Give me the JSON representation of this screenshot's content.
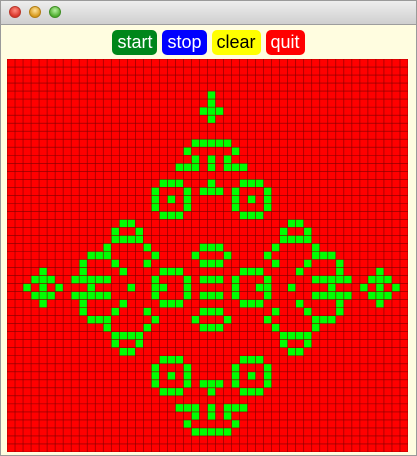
{
  "window": {
    "title": ""
  },
  "toolbar": {
    "buttons": [
      {
        "id": "start",
        "label": "start",
        "bg": "#00861a",
        "fg": "#ffffff"
      },
      {
        "id": "stop",
        "label": "stop",
        "bg": "#0000ff",
        "fg": "#ffffff"
      },
      {
        "id": "clear",
        "label": "clear",
        "bg": "#ffff00",
        "fg": "#000000"
      },
      {
        "id": "quit",
        "label": "quit",
        "bg": "#ff0000",
        "fg": "#ffffff"
      }
    ]
  },
  "grid": {
    "cols": 50,
    "rows": 49,
    "dead_color": "#ff0000",
    "alive_color": "#00ff00",
    "line_color": "#7f0000",
    "alive_cells": [
      [
        25,
        4
      ],
      [
        25,
        5
      ],
      [
        24,
        6
      ],
      [
        25,
        6
      ],
      [
        26,
        6
      ],
      [
        25,
        7
      ],
      [
        23,
        10
      ],
      [
        24,
        10
      ],
      [
        25,
        10
      ],
      [
        26,
        10
      ],
      [
        27,
        10
      ],
      [
        22,
        11
      ],
      [
        28,
        11
      ],
      [
        23,
        12
      ],
      [
        25,
        12
      ],
      [
        27,
        12
      ],
      [
        21,
        13
      ],
      [
        22,
        13
      ],
      [
        23,
        13
      ],
      [
        25,
        13
      ],
      [
        27,
        13
      ],
      [
        28,
        13
      ],
      [
        29,
        13
      ],
      [
        19,
        15
      ],
      [
        20,
        15
      ],
      [
        21,
        15
      ],
      [
        25,
        15
      ],
      [
        29,
        15
      ],
      [
        30,
        15
      ],
      [
        31,
        15
      ],
      [
        18,
        16
      ],
      [
        22,
        16
      ],
      [
        24,
        16
      ],
      [
        25,
        16
      ],
      [
        26,
        16
      ],
      [
        28,
        16
      ],
      [
        32,
        16
      ],
      [
        18,
        17
      ],
      [
        20,
        17
      ],
      [
        22,
        17
      ],
      [
        28,
        17
      ],
      [
        30,
        17
      ],
      [
        32,
        17
      ],
      [
        18,
        18
      ],
      [
        22,
        18
      ],
      [
        28,
        18
      ],
      [
        32,
        18
      ],
      [
        19,
        19
      ],
      [
        20,
        19
      ],
      [
        21,
        19
      ],
      [
        29,
        19
      ],
      [
        30,
        19
      ],
      [
        31,
        19
      ],
      [
        14,
        20
      ],
      [
        15,
        20
      ],
      [
        35,
        20
      ],
      [
        36,
        20
      ],
      [
        13,
        21
      ],
      [
        16,
        21
      ],
      [
        34,
        21
      ],
      [
        37,
        21
      ],
      [
        13,
        22
      ],
      [
        14,
        22
      ],
      [
        15,
        22
      ],
      [
        16,
        22
      ],
      [
        34,
        22
      ],
      [
        35,
        22
      ],
      [
        36,
        22
      ],
      [
        37,
        22
      ],
      [
        12,
        23
      ],
      [
        17,
        23
      ],
      [
        24,
        23
      ],
      [
        25,
        23
      ],
      [
        26,
        23
      ],
      [
        33,
        23
      ],
      [
        38,
        23
      ],
      [
        10,
        24
      ],
      [
        11,
        24
      ],
      [
        12,
        24
      ],
      [
        18,
        24
      ],
      [
        23,
        24
      ],
      [
        27,
        24
      ],
      [
        32,
        24
      ],
      [
        38,
        24
      ],
      [
        39,
        24
      ],
      [
        40,
        24
      ],
      [
        9,
        25
      ],
      [
        13,
        25
      ],
      [
        17,
        25
      ],
      [
        24,
        25
      ],
      [
        25,
        25
      ],
      [
        26,
        25
      ],
      [
        33,
        25
      ],
      [
        37,
        25
      ],
      [
        41,
        25
      ],
      [
        4,
        26
      ],
      [
        9,
        26
      ],
      [
        14,
        26
      ],
      [
        19,
        26
      ],
      [
        20,
        26
      ],
      [
        21,
        26
      ],
      [
        29,
        26
      ],
      [
        30,
        26
      ],
      [
        31,
        26
      ],
      [
        36,
        26
      ],
      [
        41,
        26
      ],
      [
        46,
        26
      ],
      [
        3,
        27
      ],
      [
        4,
        27
      ],
      [
        5,
        27
      ],
      [
        8,
        27
      ],
      [
        9,
        27
      ],
      [
        10,
        27
      ],
      [
        11,
        27
      ],
      [
        12,
        27
      ],
      [
        18,
        27
      ],
      [
        22,
        27
      ],
      [
        24,
        27
      ],
      [
        25,
        27
      ],
      [
        26,
        27
      ],
      [
        28,
        27
      ],
      [
        32,
        27
      ],
      [
        38,
        27
      ],
      [
        39,
        27
      ],
      [
        40,
        27
      ],
      [
        41,
        27
      ],
      [
        42,
        27
      ],
      [
        45,
        27
      ],
      [
        46,
        27
      ],
      [
        47,
        27
      ],
      [
        2,
        28
      ],
      [
        4,
        28
      ],
      [
        6,
        28
      ],
      [
        10,
        28
      ],
      [
        15,
        28
      ],
      [
        18,
        28
      ],
      [
        19,
        28
      ],
      [
        22,
        28
      ],
      [
        28,
        28
      ],
      [
        31,
        28
      ],
      [
        32,
        28
      ],
      [
        35,
        28
      ],
      [
        40,
        28
      ],
      [
        44,
        28
      ],
      [
        46,
        28
      ],
      [
        48,
        28
      ],
      [
        3,
        29
      ],
      [
        4,
        29
      ],
      [
        5,
        29
      ],
      [
        8,
        29
      ],
      [
        9,
        29
      ],
      [
        10,
        29
      ],
      [
        11,
        29
      ],
      [
        12,
        29
      ],
      [
        18,
        29
      ],
      [
        22,
        29
      ],
      [
        24,
        29
      ],
      [
        25,
        29
      ],
      [
        26,
        29
      ],
      [
        28,
        29
      ],
      [
        32,
        29
      ],
      [
        38,
        29
      ],
      [
        39,
        29
      ],
      [
        40,
        29
      ],
      [
        41,
        29
      ],
      [
        42,
        29
      ],
      [
        45,
        29
      ],
      [
        46,
        29
      ],
      [
        47,
        29
      ],
      [
        4,
        30
      ],
      [
        9,
        30
      ],
      [
        14,
        30
      ],
      [
        19,
        30
      ],
      [
        20,
        30
      ],
      [
        21,
        30
      ],
      [
        29,
        30
      ],
      [
        30,
        30
      ],
      [
        31,
        30
      ],
      [
        36,
        30
      ],
      [
        41,
        30
      ],
      [
        46,
        30
      ],
      [
        9,
        31
      ],
      [
        13,
        31
      ],
      [
        17,
        31
      ],
      [
        24,
        31
      ],
      [
        25,
        31
      ],
      [
        26,
        31
      ],
      [
        33,
        31
      ],
      [
        37,
        31
      ],
      [
        41,
        31
      ],
      [
        10,
        32
      ],
      [
        11,
        32
      ],
      [
        12,
        32
      ],
      [
        18,
        32
      ],
      [
        23,
        32
      ],
      [
        27,
        32
      ],
      [
        32,
        32
      ],
      [
        38,
        32
      ],
      [
        39,
        32
      ],
      [
        40,
        32
      ],
      [
        12,
        33
      ],
      [
        17,
        33
      ],
      [
        24,
        33
      ],
      [
        25,
        33
      ],
      [
        26,
        33
      ],
      [
        33,
        33
      ],
      [
        38,
        33
      ],
      [
        13,
        34
      ],
      [
        14,
        34
      ],
      [
        15,
        34
      ],
      [
        16,
        34
      ],
      [
        34,
        34
      ],
      [
        35,
        34
      ],
      [
        36,
        34
      ],
      [
        37,
        34
      ],
      [
        13,
        35
      ],
      [
        16,
        35
      ],
      [
        34,
        35
      ],
      [
        37,
        35
      ],
      [
        14,
        36
      ],
      [
        15,
        36
      ],
      [
        35,
        36
      ],
      [
        36,
        36
      ],
      [
        19,
        37
      ],
      [
        20,
        37
      ],
      [
        21,
        37
      ],
      [
        29,
        37
      ],
      [
        30,
        37
      ],
      [
        31,
        37
      ],
      [
        18,
        38
      ],
      [
        22,
        38
      ],
      [
        28,
        38
      ],
      [
        32,
        38
      ],
      [
        18,
        39
      ],
      [
        20,
        39
      ],
      [
        22,
        39
      ],
      [
        28,
        39
      ],
      [
        30,
        39
      ],
      [
        32,
        39
      ],
      [
        18,
        40
      ],
      [
        22,
        40
      ],
      [
        24,
        40
      ],
      [
        25,
        40
      ],
      [
        26,
        40
      ],
      [
        28,
        40
      ],
      [
        32,
        40
      ],
      [
        19,
        41
      ],
      [
        20,
        41
      ],
      [
        21,
        41
      ],
      [
        25,
        41
      ],
      [
        29,
        41
      ],
      [
        30,
        41
      ],
      [
        31,
        41
      ],
      [
        21,
        43
      ],
      [
        22,
        43
      ],
      [
        23,
        43
      ],
      [
        25,
        43
      ],
      [
        27,
        43
      ],
      [
        28,
        43
      ],
      [
        29,
        43
      ],
      [
        23,
        44
      ],
      [
        25,
        44
      ],
      [
        27,
        44
      ],
      [
        22,
        45
      ],
      [
        28,
        45
      ],
      [
        23,
        46
      ],
      [
        24,
        46
      ],
      [
        25,
        46
      ],
      [
        26,
        46
      ],
      [
        27,
        46
      ]
    ]
  }
}
